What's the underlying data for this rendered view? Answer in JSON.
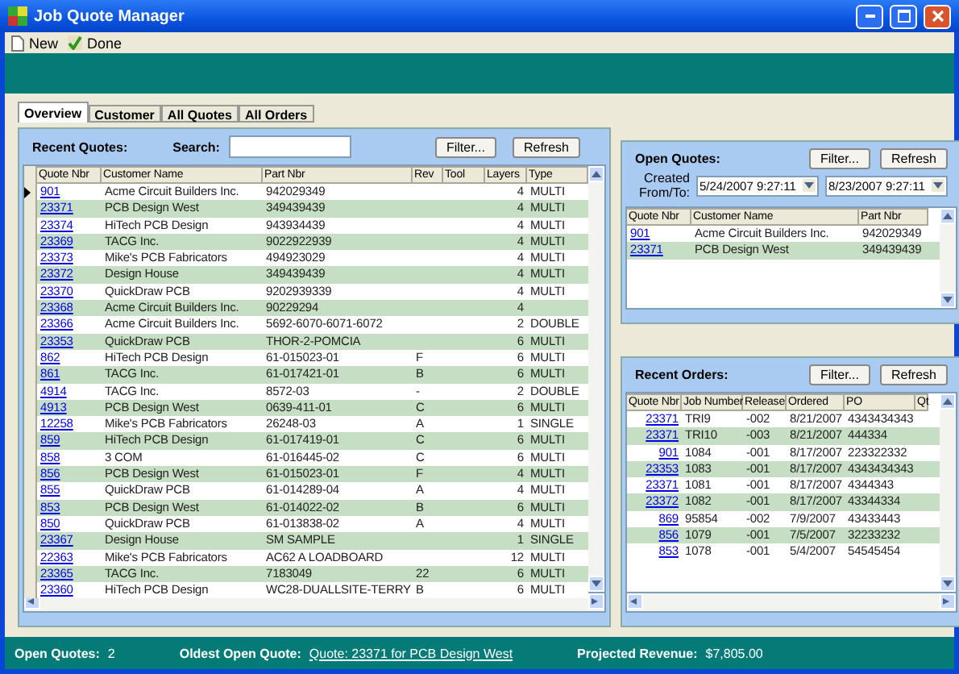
{
  "window": {
    "title": "Job Quote Manager"
  },
  "toolbar": [
    {
      "label": "New",
      "kind": "document"
    },
    {
      "label": "Done",
      "kind": "check"
    }
  ],
  "tabs": [
    {
      "label": "Overview",
      "selected": true
    },
    {
      "label": "Customer",
      "selected": false
    },
    {
      "label": "All Quotes",
      "selected": false
    },
    {
      "label": "All Orders",
      "selected": false
    }
  ],
  "recent_quotes": {
    "title": "Recent Quotes:",
    "search_label": "Search:",
    "buttons": [
      "Filter...",
      "Refresh"
    ],
    "columns": [
      "Quote Nbr",
      "Customer Name",
      "Part Nbr",
      "Rev",
      "Tool",
      "Layers",
      "Type"
    ],
    "rows": [
      {
        "current": true,
        "cells": [
          "901",
          "Acme Circuit Builders Inc.",
          "942029349",
          "",
          "",
          "4",
          "MULTI"
        ]
      },
      {
        "current": false,
        "cells": [
          "23371",
          "PCB Design West",
          "349439439",
          "",
          "",
          "4",
          "MULTI"
        ]
      },
      {
        "current": false,
        "cells": [
          "23374",
          "HiTech PCB Design",
          "943934439",
          "",
          "",
          "4",
          "MULTI"
        ]
      },
      {
        "current": false,
        "cells": [
          "23369",
          "TACG Inc.",
          "9022922939",
          "",
          "",
          "4",
          "MULTI"
        ]
      },
      {
        "current": false,
        "cells": [
          "23373",
          "Mike's PCB Fabricators",
          "494923029",
          "",
          "",
          "4",
          "MULTI"
        ]
      },
      {
        "current": false,
        "cells": [
          "23372",
          "Design House",
          "349439439",
          "",
          "",
          "4",
          "MULTI"
        ]
      },
      {
        "current": false,
        "cells": [
          "23370",
          "QuickDraw PCB",
          "9202939339",
          "",
          "",
          "4",
          "MULTI"
        ]
      },
      {
        "current": false,
        "cells": [
          "23368",
          "Acme Circuit Builders Inc.",
          "90229294",
          "",
          "",
          "4",
          ""
        ]
      },
      {
        "current": false,
        "cells": [
          "23366",
          "Acme Circuit Builders Inc.",
          "5692-6070-6071-6072",
          "",
          "",
          "2",
          "DOUBLE"
        ]
      },
      {
        "current": false,
        "cells": [
          "23353",
          "QuickDraw PCB",
          "THOR-2-POMCIA",
          "",
          "",
          "6",
          "MULTI"
        ]
      },
      {
        "current": false,
        "cells": [
          "862",
          "HiTech PCB Design",
          "61-015023-01",
          "F",
          "",
          "6",
          "MULTI"
        ]
      },
      {
        "current": false,
        "cells": [
          "861",
          "TACG Inc.",
          "61-017421-01",
          "B",
          "",
          "6",
          "MULTI"
        ]
      },
      {
        "current": false,
        "cells": [
          "4914",
          "TACG Inc.",
          "8572-03",
          "-",
          "",
          "2",
          "DOUBLE"
        ]
      },
      {
        "current": false,
        "cells": [
          "4913",
          "PCB Design West",
          "0639-411-01",
          "C",
          "",
          "6",
          "MULTI"
        ]
      },
      {
        "current": false,
        "cells": [
          "12258",
          "Mike's PCB Fabricators",
          "26248-03",
          "A",
          "",
          "1",
          "SINGLE"
        ]
      },
      {
        "current": false,
        "cells": [
          "859",
          "HiTech PCB Design",
          "61-017419-01",
          "C",
          "",
          "6",
          "MULTI"
        ]
      },
      {
        "current": false,
        "cells": [
          "858",
          "3 COM",
          "61-016445-02",
          "C",
          "",
          "6",
          "MULTI"
        ]
      },
      {
        "current": false,
        "cells": [
          "856",
          "PCB Design West",
          "61-015023-01",
          "F",
          "",
          "4",
          "MULTI"
        ]
      },
      {
        "current": false,
        "cells": [
          "855",
          "QuickDraw PCB",
          "61-014289-04",
          "A",
          "",
          "4",
          "MULTI"
        ]
      },
      {
        "current": false,
        "cells": [
          "853",
          "PCB Design West",
          "61-014022-02",
          "B",
          "",
          "6",
          "MULTI"
        ]
      },
      {
        "current": false,
        "cells": [
          "850",
          "QuickDraw PCB",
          "61-013838-02",
          "A",
          "",
          "4",
          "MULTI"
        ]
      },
      {
        "current": false,
        "cells": [
          "23367",
          "Design House",
          "SM SAMPLE",
          "",
          "",
          "1",
          "SINGLE"
        ]
      },
      {
        "current": false,
        "cells": [
          "22363",
          "Mike's PCB Fabricators",
          "AC62 A LOADBOARD",
          "",
          "",
          "12",
          "MULTI"
        ]
      },
      {
        "current": false,
        "cells": [
          "23365",
          "TACG Inc.",
          "7183049",
          "22",
          "",
          "6",
          "MULTI"
        ]
      },
      {
        "current": false,
        "cells": [
          "23360",
          "HiTech PCB Design",
          "WC28-DUALLSITE-TERRY",
          "B",
          "",
          "6",
          "MULTI"
        ]
      }
    ]
  },
  "open_quotes": {
    "title": "Open Quotes:",
    "created_label": "Created From/To:",
    "from": "5/24/2007 9:27:11",
    "to": "8/23/2007 9:27:11",
    "buttons": [
      "Filter...",
      "Refresh"
    ],
    "columns": [
      "Quote Nbr",
      "Customer Name",
      "Part Nbr"
    ],
    "rows": [
      {
        "cells": [
          "901",
          "Acme Circuit Builders Inc.",
          "942029349"
        ]
      },
      {
        "cells": [
          "23371",
          "PCB Design West",
          "349439439"
        ]
      }
    ]
  },
  "recent_orders": {
    "title": "Recent Orders:",
    "buttons": [
      "Filter...",
      "Refresh"
    ],
    "columns": [
      "Quote Nbr",
      "Job Number",
      "Release",
      "Ordered",
      "PO",
      "Qt"
    ],
    "rows": [
      {
        "cells": [
          "23371",
          "TRI9",
          "-002",
          "8/21/2007",
          "4343434343"
        ]
      },
      {
        "cells": [
          "23371",
          "TRI10",
          "-003",
          "8/21/2007",
          "444334"
        ]
      },
      {
        "cells": [
          "901",
          "1084",
          "-001",
          "8/17/2007",
          "223322332"
        ]
      },
      {
        "cells": [
          "23353",
          "1083",
          "-001",
          "8/17/2007",
          "4343434343"
        ]
      },
      {
        "cells": [
          "23371",
          "1081",
          "-001",
          "8/17/2007",
          "4344343"
        ]
      },
      {
        "cells": [
          "23372",
          "1082",
          "-001",
          "8/17/2007",
          "43344334"
        ]
      },
      {
        "cells": [
          "869",
          "95854",
          "-002",
          "7/9/2007",
          "43433443"
        ]
      },
      {
        "cells": [
          "856",
          "1079",
          "-001",
          "7/5/2007",
          "32233232"
        ]
      },
      {
        "cells": [
          "853",
          "1078",
          "-001",
          "5/4/2007",
          "54545454"
        ]
      }
    ]
  },
  "status_bar": [
    {
      "label": "Open Quotes:",
      "value": "2",
      "link": false
    },
    {
      "label": "Oldest Open Quote:",
      "value": "Quote: 23371 for PCB Design West",
      "link": true
    },
    {
      "label": "Projected Revenue:",
      "value": "$7,805.00",
      "link": false
    }
  ]
}
